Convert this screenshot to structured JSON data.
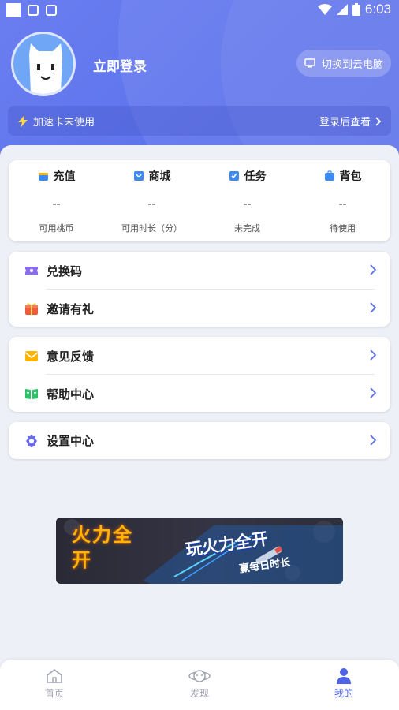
{
  "statusbar": {
    "time": "6:03"
  },
  "profile": {
    "login_label": "立即登录",
    "switch_label": "切换到云电脑"
  },
  "speed_card": {
    "status_label": "加速卡未使用",
    "action_label": "登录后查看"
  },
  "stats": [
    {
      "title": "充值",
      "value": "--",
      "sub": "可用桃币",
      "icon": "wallet-icon"
    },
    {
      "title": "商城",
      "value": "--",
      "sub": "可用时长（分）",
      "icon": "store-icon"
    },
    {
      "title": "任务",
      "value": "--",
      "sub": "未完成",
      "icon": "task-icon"
    },
    {
      "title": "背包",
      "value": "--",
      "sub": "待使用",
      "icon": "backpack-icon"
    }
  ],
  "menu_group1": [
    {
      "label": "兑换码",
      "icon": "ticket-icon"
    },
    {
      "label": "邀请有礼",
      "icon": "gift-icon"
    }
  ],
  "menu_group2": [
    {
      "label": "意见反馈",
      "icon": "mail-icon"
    },
    {
      "label": "帮助中心",
      "icon": "book-icon"
    }
  ],
  "menu_group3": [
    {
      "label": "设置中心",
      "icon": "gear-icon"
    }
  ],
  "banner": {
    "logo_text": "火力全开",
    "headline": "玩火力全开",
    "subline": "赢每日时长"
  },
  "tabbar": [
    {
      "label": "首页",
      "icon": "home-icon",
      "active": false
    },
    {
      "label": "发现",
      "icon": "planet-icon",
      "active": false
    },
    {
      "label": "我的",
      "icon": "user-icon",
      "active": true
    }
  ],
  "colors": {
    "accent": "#5a6fe9",
    "active_tab": "#4f63e6"
  }
}
